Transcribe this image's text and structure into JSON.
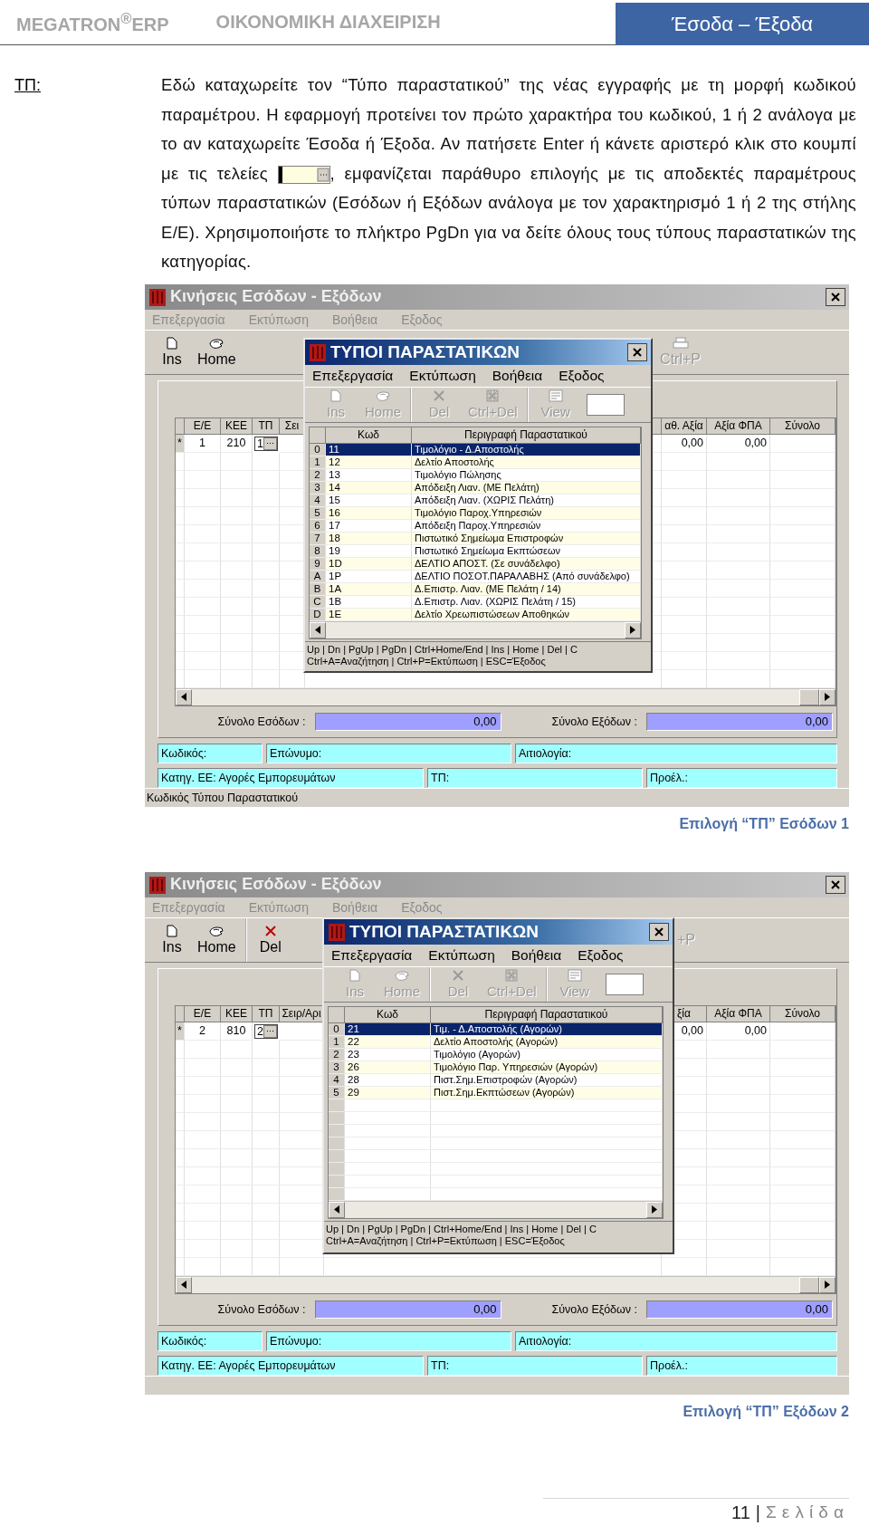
{
  "header": {
    "brand": "MEGATRON$^{®}$ERP",
    "section": "ΟΙΚΟΝΟΜΙΚΗ ΔΙΑΧΕΙΡΙΣΗ",
    "chapter": "Έσοδα – Έξοδα"
  },
  "field_label": "ΤΠ:",
  "paragraph": {
    "before": "Εδώ καταχωρείτε τον “Τύπο παραστατικού” της νέας εγγραφής με τη μορφή κωδικού παραμέτρου. Η εφαρμογή προτείνει τον πρώτο χαρακτήρα του κωδικού, 1 ή 2 ανάλογα με το αν καταχωρείτε Έσοδα ή Έξοδα. Αν πατήσετε Enter ή κάνετε αριστερό κλικ στο κουμπί με τις τελείες",
    "after": ", εμφανίζεται παράθυρο επιλογής με τις αποδεκτές παραμέτρους τύπων παραστατικών (Εσόδων ή Εξόδων ανάλογα με τον χαρακτηρισμό 1 ή 2 της στήλης Ε/Ε). Χρησιμοποιήστε το πλήκτρο PgDn για να δείτε όλους τους τύπους παραστατικών της κατηγορίας."
  },
  "screenshots": [
    {
      "window": {
        "title": "Κινήσεις Εσόδων - Εξόδων",
        "active": false,
        "menu": [
          "Επεξεργασία",
          "Εκτύπωση",
          "Βοήθεια",
          "Εξοδος"
        ],
        "toolbar_left": [
          [
            {
              "kind": "new",
              "label": "Ins",
              "disabled": false
            },
            {
              "kind": "home",
              "label": "Home",
              "disabled": false
            }
          ]
        ],
        "toolbar_right": [
          [
            {
              "kind": "print",
              "label": "Ctrl+P",
              "disabled": true
            }
          ]
        ],
        "columns_left": [
          "Ε/Ε",
          "ΚΕΕ",
          "ΤΠ",
          "Σει"
        ],
        "columns_right": [
          "αθ. Αξία",
          "Αξία ΦΠΑ",
          "Σύνολο"
        ],
        "row": {
          "marker": "*",
          "values": [
            "1",
            "210"
          ],
          "tp": "1",
          "right_values": [
            "0,00",
            "0,00"
          ]
        },
        "totals": [
          {
            "label": "Σύνολο Εσόδων :",
            "value": "0,00"
          },
          {
            "label": "Σύνολο Εξόδων :",
            "value": "0,00"
          }
        ],
        "info_rows": [
          [
            "Κωδικός:",
            "Επώνυμο:",
            "Αιτιολογία:"
          ],
          [
            "Κατηγ. ΕΕ: Αγορές Εμπορευμάτων",
            "ΤΠ:",
            "Προέλ.:"
          ]
        ],
        "status": "Κωδικός Τύπου Παραστατικού"
      },
      "dialog": {
        "title": "ΤΥΠΟΙ ΠΑΡΑΣΤΑΤΙΚΩΝ",
        "active": true,
        "menu": [
          "Επεξεργασία",
          "Εκτύπωση",
          "Βοήθεια",
          "Εξοδος"
        ],
        "toolbar": [
          [
            {
              "kind": "new",
              "label": "Ins",
              "disabled": true
            },
            {
              "kind": "home",
              "label": "Home",
              "disabled": true
            }
          ],
          [
            {
              "kind": "delete",
              "label": "Del",
              "disabled": true
            },
            {
              "kind": "delete-all",
              "label": "Ctrl+Del",
              "disabled": true
            }
          ],
          [
            {
              "kind": "view",
              "label": "View",
              "disabled": true
            }
          ]
        ],
        "columns": [
          "Κωδ",
          "Περιγραφή Παραστατικού"
        ],
        "rows": [
          {
            "index": "0",
            "code": "11",
            "description": "Τιμολόγιο - Δ.Αποστολής",
            "selected": true
          },
          {
            "index": "1",
            "code": "12",
            "description": "Δελτίο Αποστολής",
            "selected": false
          },
          {
            "index": "2",
            "code": "13",
            "description": "Τιμολόγιο Πώλησης",
            "selected": false
          },
          {
            "index": "3",
            "code": "14",
            "description": "Απόδειξη Λιαν. (ΜΕ Πελάτη)",
            "selected": false
          },
          {
            "index": "4",
            "code": "15",
            "description": "Απόδειξη Λιαν. (ΧΩΡΙΣ Πελάτη)",
            "selected": false
          },
          {
            "index": "5",
            "code": "16",
            "description": "Τιμολόγιο Παροχ.Υπηρεσιών",
            "selected": false
          },
          {
            "index": "6",
            "code": "17",
            "description": "Απόδειξη Παροχ.Υπηρεσιών",
            "selected": false
          },
          {
            "index": "7",
            "code": "18",
            "description": "Πιστωτικό Σημείωμα Επιστροφών",
            "selected": false
          },
          {
            "index": "8",
            "code": "19",
            "description": "Πιστωτικό Σημείωμα Εκπτώσεων",
            "selected": false
          },
          {
            "index": "9",
            "code": "1D",
            "description": "ΔΕΛΤΙΟ ΑΠΟΣΤ. (Σε συνάδελφο)",
            "selected": false
          },
          {
            "index": "A",
            "code": "1P",
            "description": "ΔΕΛΤΙΟ ΠΟΣΟΤ.ΠΑΡΑΛΑΒΗΣ (Από συνάδελφο)",
            "selected": false
          },
          {
            "index": "B",
            "code": "1A",
            "description": "Δ.Επιστρ. Λιαν. (ΜΕ Πελάτη / 14)",
            "selected": false
          },
          {
            "index": "C",
            "code": "1B",
            "description": "Δ.Επιστρ. Λιαν. (ΧΩΡΙΣ Πελάτη / 15)",
            "selected": false
          },
          {
            "index": "D",
            "code": "1E",
            "description": "Δελτίο Χρεωπιστώσεων Αποθηκών",
            "selected": false
          }
        ],
        "status_lines": [
          "Up | Dn | PgUp | PgDn | Ctrl+Home/End | Ins | Home | Del | C",
          "Ctrl+A=Αναζήτηση | Ctrl+P=Εκτύπωση | ESC=Έξοδος"
        ]
      },
      "caption": "Επιλογή “ΤΠ” Εσόδων 1"
    },
    {
      "window": {
        "title": "Κινήσεις Εσόδων - Εξόδων",
        "active": false,
        "menu": [
          "Επεξεργασία",
          "Εκτύπωση",
          "Βοήθεια",
          "Εξοδος"
        ],
        "toolbar_left": [
          [
            {
              "kind": "new",
              "label": "Ins",
              "disabled": false
            },
            {
              "kind": "home",
              "label": "Home",
              "disabled": false
            }
          ],
          [
            {
              "kind": "delete",
              "label": "Del",
              "disabled": false
            }
          ]
        ],
        "toolbar_right": [
          [
            {
              "kind": "text",
              "label": "+P",
              "disabled": true
            }
          ]
        ],
        "columns_left": [
          "Ε/Ε",
          "ΚΕΕ",
          "ΤΠ",
          "Σειρ/Αρι"
        ],
        "columns_right": [
          "ξία",
          "Αξία ΦΠΑ",
          "Σύνολο"
        ],
        "row": {
          "marker": "*",
          "values": [
            "2",
            "810"
          ],
          "tp": "2",
          "right_values": [
            "0,00",
            "0,00"
          ]
        },
        "totals": [
          {
            "label": "Σύνολο Εσόδων :",
            "value": "0,00"
          },
          {
            "label": "Σύνολο Εξόδων :",
            "value": "0,00"
          }
        ],
        "info_rows": [
          [
            "Κωδικός:",
            "Επώνυμο:",
            "Αιτιολογία:"
          ],
          [
            "Κατηγ. ΕΕ: Αγορές Εμπορευμάτων",
            "ΤΠ:",
            "Προέλ.:"
          ]
        ]
      },
      "dialog": {
        "title": "ΤΥΠΟΙ ΠΑΡΑΣΤΑΤΙΚΩΝ",
        "active": true,
        "menu": [
          "Επεξεργασία",
          "Εκτύπωση",
          "Βοήθεια",
          "Εξοδος"
        ],
        "toolbar": [
          [
            {
              "kind": "new",
              "label": "Ins",
              "disabled": true
            },
            {
              "kind": "home",
              "label": "Home",
              "disabled": true
            }
          ],
          [
            {
              "kind": "delete",
              "label": "Del",
              "disabled": true
            },
            {
              "kind": "delete-all",
              "label": "Ctrl+Del",
              "disabled": true
            }
          ],
          [
            {
              "kind": "view",
              "label": "View",
              "disabled": true
            }
          ]
        ],
        "columns": [
          "Κωδ",
          "Περιγραφή Παραστατικού"
        ],
        "rows": [
          {
            "index": "0",
            "code": "21",
            "description": "Τιμ. - Δ.Αποστολής (Αγορών)",
            "selected": true
          },
          {
            "index": "1",
            "code": "22",
            "description": "Δελτίο Αποστολής (Αγορών)",
            "selected": false
          },
          {
            "index": "2",
            "code": "23",
            "description": "Τιμολόγιο (Αγορών)",
            "selected": false
          },
          {
            "index": "3",
            "code": "26",
            "description": "Τιμολόγιο Παρ. Υπηρεσιών (Αγορών)",
            "selected": false
          },
          {
            "index": "4",
            "code": "28",
            "description": "Πιστ.Σημ.Επιστροφών (Αγορών)",
            "selected": false
          },
          {
            "index": "5",
            "code": "29",
            "description": "Πιστ.Σημ.Εκπτώσεων (Αγορών)",
            "selected": false
          }
        ],
        "status_lines": [
          "Up | Dn | PgUp | PgDn | Ctrl+Home/End | Ins | Home | Del | C",
          "Ctrl+A=Αναζήτηση | Ctrl+P=Εκτύπωση | ESC=Έξοδος"
        ]
      },
      "caption": "Επιλογή “ΤΠ” Εξόδων 2"
    }
  ],
  "footer": {
    "page": "11",
    "separator": "|",
    "label": "Σελίδα"
  }
}
